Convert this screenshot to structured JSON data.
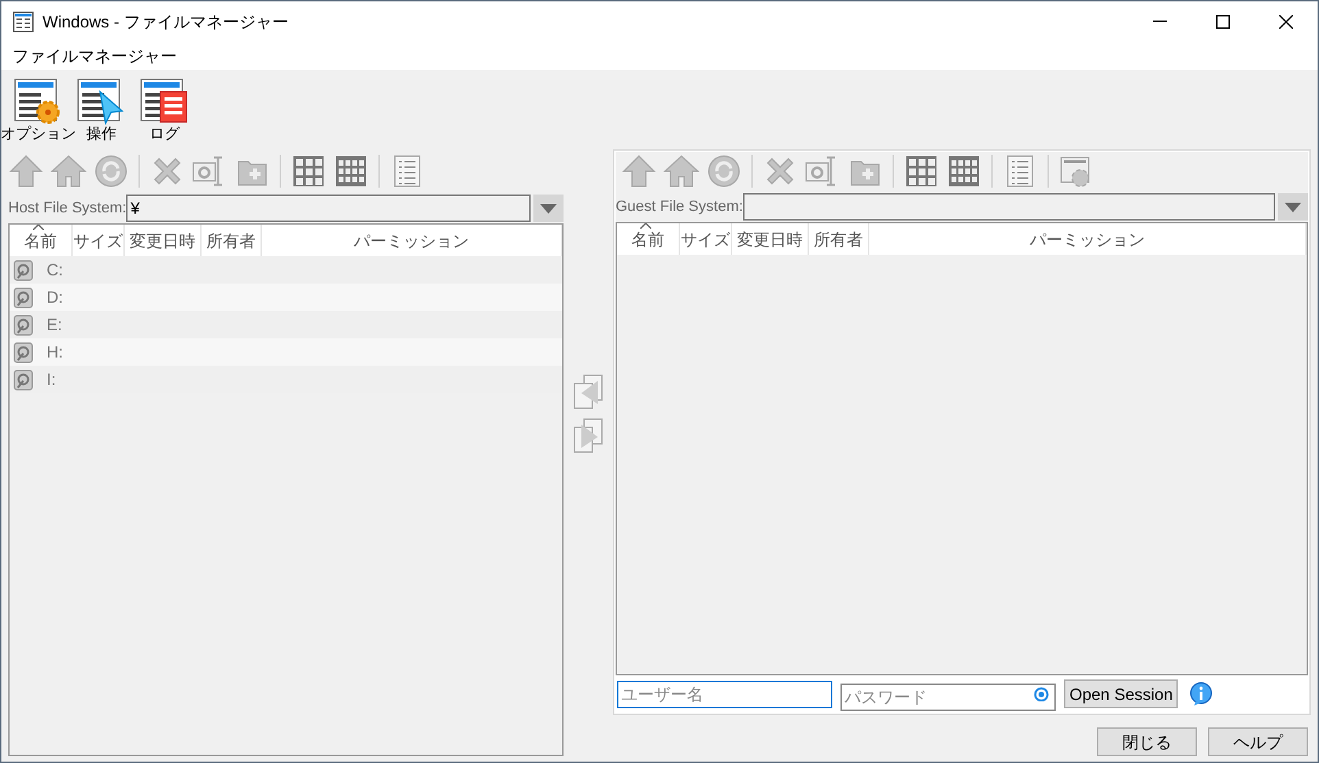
{
  "window": {
    "title": "Windows - ファイルマネージャー"
  },
  "menu": [
    "ファイルマネージャー"
  ],
  "ribbon": [
    {
      "kind": "options",
      "label": "オプション"
    },
    {
      "kind": "operate",
      "label": "操作"
    },
    {
      "kind": "log",
      "label": "ログ"
    }
  ],
  "host": {
    "label": "Host File System:",
    "path": "¥",
    "columns": [
      "名前",
      "サイズ",
      "変更日時",
      "所有者",
      "パーミッション"
    ],
    "rows": [
      {
        "name": "C:"
      },
      {
        "name": "D:"
      },
      {
        "name": "E:"
      },
      {
        "name": "H:"
      },
      {
        "name": "I:"
      }
    ]
  },
  "guest": {
    "label": "Guest File System:",
    "columns": [
      "名前",
      "サイズ",
      "変更日時",
      "所有者",
      "パーミッション"
    ],
    "username": {
      "placeholder": "ユーザー名"
    },
    "password": {
      "placeholder": "パスワード"
    },
    "open_button": "Open Session"
  },
  "buttons": [
    "閉じる",
    "ヘルプ"
  ]
}
